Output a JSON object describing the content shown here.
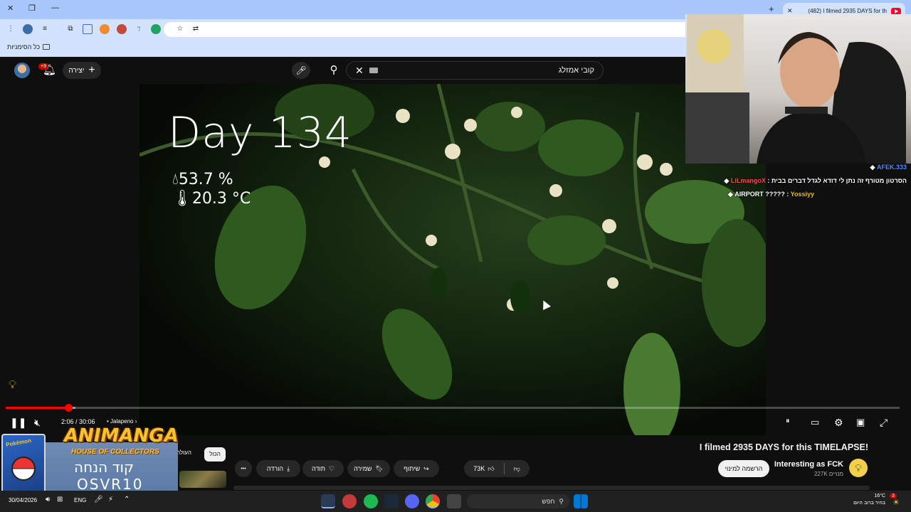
{
  "browser": {
    "tab_title": "(482) I filmed 2935 DAYS for th",
    "tab_close": "✕",
    "new_tab": "+",
    "bookmarks_all": "כל הסימניות"
  },
  "youtube": {
    "header": {
      "create_label": "יצירה",
      "notifications_badge": "+9",
      "search_query": "קובי אמזלג"
    },
    "video": {
      "overlay_day": "Day 134",
      "overlay_humidity": "53.7 %",
      "overlay_temperature": "20.3 °C",
      "time_display": "2:06 / 30:06",
      "chapter": "Jalapeno",
      "progress_fraction": 0.07,
      "loaded_fraction": 0.078
    },
    "below": {
      "title": "I filmed 2935 DAYS for this TIMELAPSE!",
      "channel_name": "Interesting as FCK",
      "channel_subs": "227K מנויים",
      "subscribe_label": "הרשמה למינוי",
      "like_count": "73K",
      "share_label": "שיתוף",
      "save_label": "שמירה",
      "thanks_label": "תודה",
      "download_label": "הורדה",
      "more_label": "•••",
      "filter_all": "הכול",
      "filter_uploads": "העולה"
    }
  },
  "stream_overlay": {
    "chat": [
      {
        "user": "AFEK.333",
        "message": "",
        "color": "blue"
      },
      {
        "user": "LiLmangoX",
        "message": "הסרטון מטורף זה נתן לי דודא לגדל דברים בבית",
        "color": "red"
      },
      {
        "user": "Yossiyy",
        "message": "AIRPORT ?????",
        "color": "red"
      }
    ],
    "promo": {
      "card_brand": "Pokémon",
      "brand": "ANIMANGA",
      "subtitle": "HOUSE OF COLLECTORS",
      "code_label": "קוד הנחה",
      "code": "OSVR10"
    }
  },
  "taskbar": {
    "date": "30/04/2026",
    "language": "ENG",
    "search_label": "חפש",
    "weather_temp": "16°C",
    "weather_desc": "בהיר ברוב היום",
    "notification_count": "3"
  }
}
